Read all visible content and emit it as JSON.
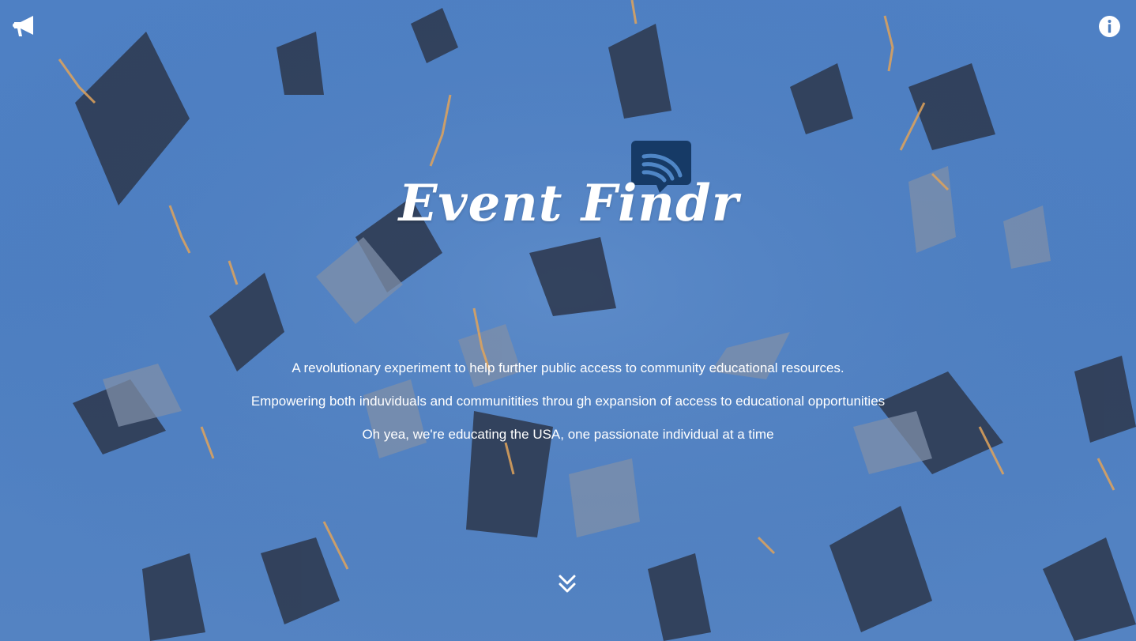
{
  "brand": {
    "name": "Event Findr"
  },
  "tagline": {
    "line1": "A revolutionary experiment to help further public access to community educational resources.",
    "line2": "Empowering both induviduals and communitities throu gh expansion of access to educational opportunities",
    "line3": "Oh yea, we're educating the USA, one passionate individual at a time"
  },
  "icons": {
    "top_left": "megaphone-icon",
    "top_right": "info-icon",
    "logo_badge": "wifi-signal-chat-icon",
    "scroll": "double-chevron-down-icon"
  },
  "colors": {
    "background": "#4f7fbf",
    "text": "#ffffff",
    "logo_badge": "#163a66"
  }
}
